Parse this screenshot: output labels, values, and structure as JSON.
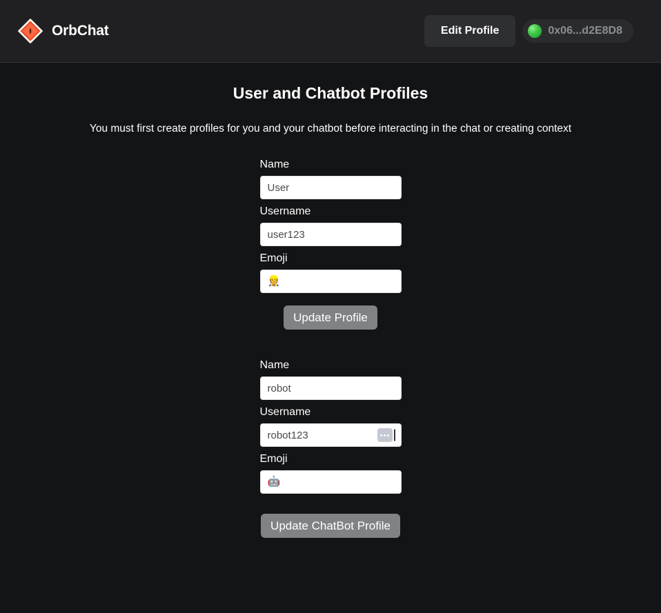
{
  "header": {
    "brand_name": "OrbChat",
    "logo_icon": "orb-diamond-logo",
    "edit_profile_label": "Edit Profile",
    "wallet": {
      "status_icon": "green-status-dot",
      "address": "0x06...d2E8D8"
    }
  },
  "main": {
    "title": "User and Chatbot Profiles",
    "subtitle": "You must first create profiles for you and your chatbot before interacting in the chat or creating context",
    "user_profile": {
      "name_label": "Name",
      "name_value": "User",
      "name_placeholder": "Name",
      "username_label": "Username",
      "username_value": "user123",
      "username_placeholder": "Username",
      "emoji_label": "Emoji",
      "emoji_value": "👷",
      "emoji_placeholder": "Emoji",
      "submit_label": "Update Profile"
    },
    "chatbot_profile": {
      "name_label": "Name",
      "name_value": "robot",
      "name_placeholder": "Name",
      "username_label": "Username",
      "username_value": "robot123",
      "username_placeholder": "Username",
      "username_autofill_icon": "autofill-dots-icon",
      "emoji_label": "Emoji",
      "emoji_value": "🤖",
      "emoji_placeholder": "Emoji",
      "submit_label": "Update ChatBot Profile"
    }
  },
  "colors": {
    "brand_accent": "#f04a25",
    "header_bg": "#202022",
    "page_bg": "#131416",
    "button_gray": "#808285",
    "status_green": "#40c64a"
  }
}
